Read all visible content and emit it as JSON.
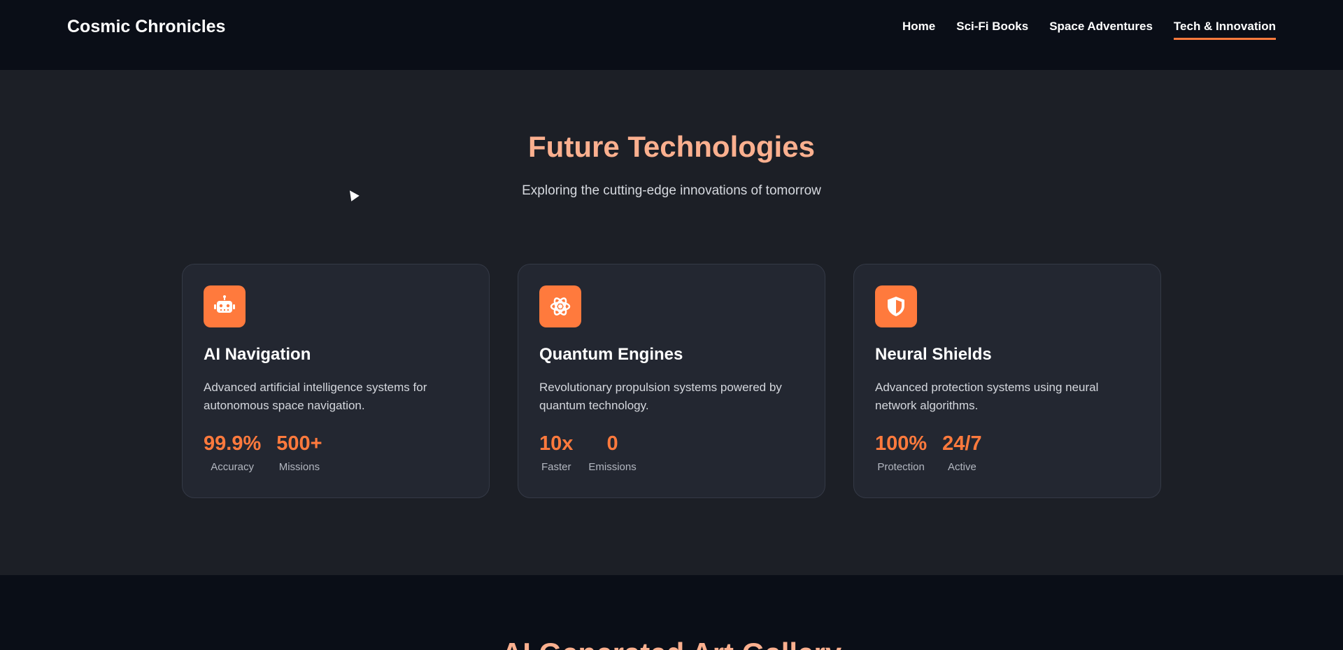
{
  "nav": {
    "brand": "Cosmic Chronicles",
    "links": [
      "Home",
      "Sci-Fi Books",
      "Space Adventures",
      "Tech & Innovation"
    ],
    "active": "Tech & Innovation"
  },
  "hero": {
    "title": "Future Technologies",
    "subtitle": "Exploring the cutting-edge innovations of tomorrow"
  },
  "cards": [
    {
      "icon": "robot-icon",
      "title": "AI Navigation",
      "description": "Advanced artificial intelligence systems for autonomous space navigation.",
      "stats": [
        {
          "value": "99.9%",
          "label": "Accuracy"
        },
        {
          "value": "500+",
          "label": "Missions"
        }
      ]
    },
    {
      "icon": "atom-icon",
      "title": "Quantum Engines",
      "description": "Revolutionary propulsion systems powered by quantum technology.",
      "stats": [
        {
          "value": "10x",
          "label": "Faster"
        },
        {
          "value": "0",
          "label": "Emissions"
        }
      ]
    },
    {
      "icon": "shield-icon",
      "title": "Neural Shields",
      "description": "Advanced protection systems using neural network algorithms.",
      "stats": [
        {
          "value": "100%",
          "label": "Protection"
        },
        {
          "value": "24/7",
          "label": "Active"
        }
      ]
    }
  ],
  "gallery": {
    "title": "AI Generated Art Gallery"
  },
  "colors": {
    "accent": "#ff7a3d",
    "heading": "#fbb08f",
    "background": "#1c1f26",
    "navbar": "#0a0e17"
  }
}
